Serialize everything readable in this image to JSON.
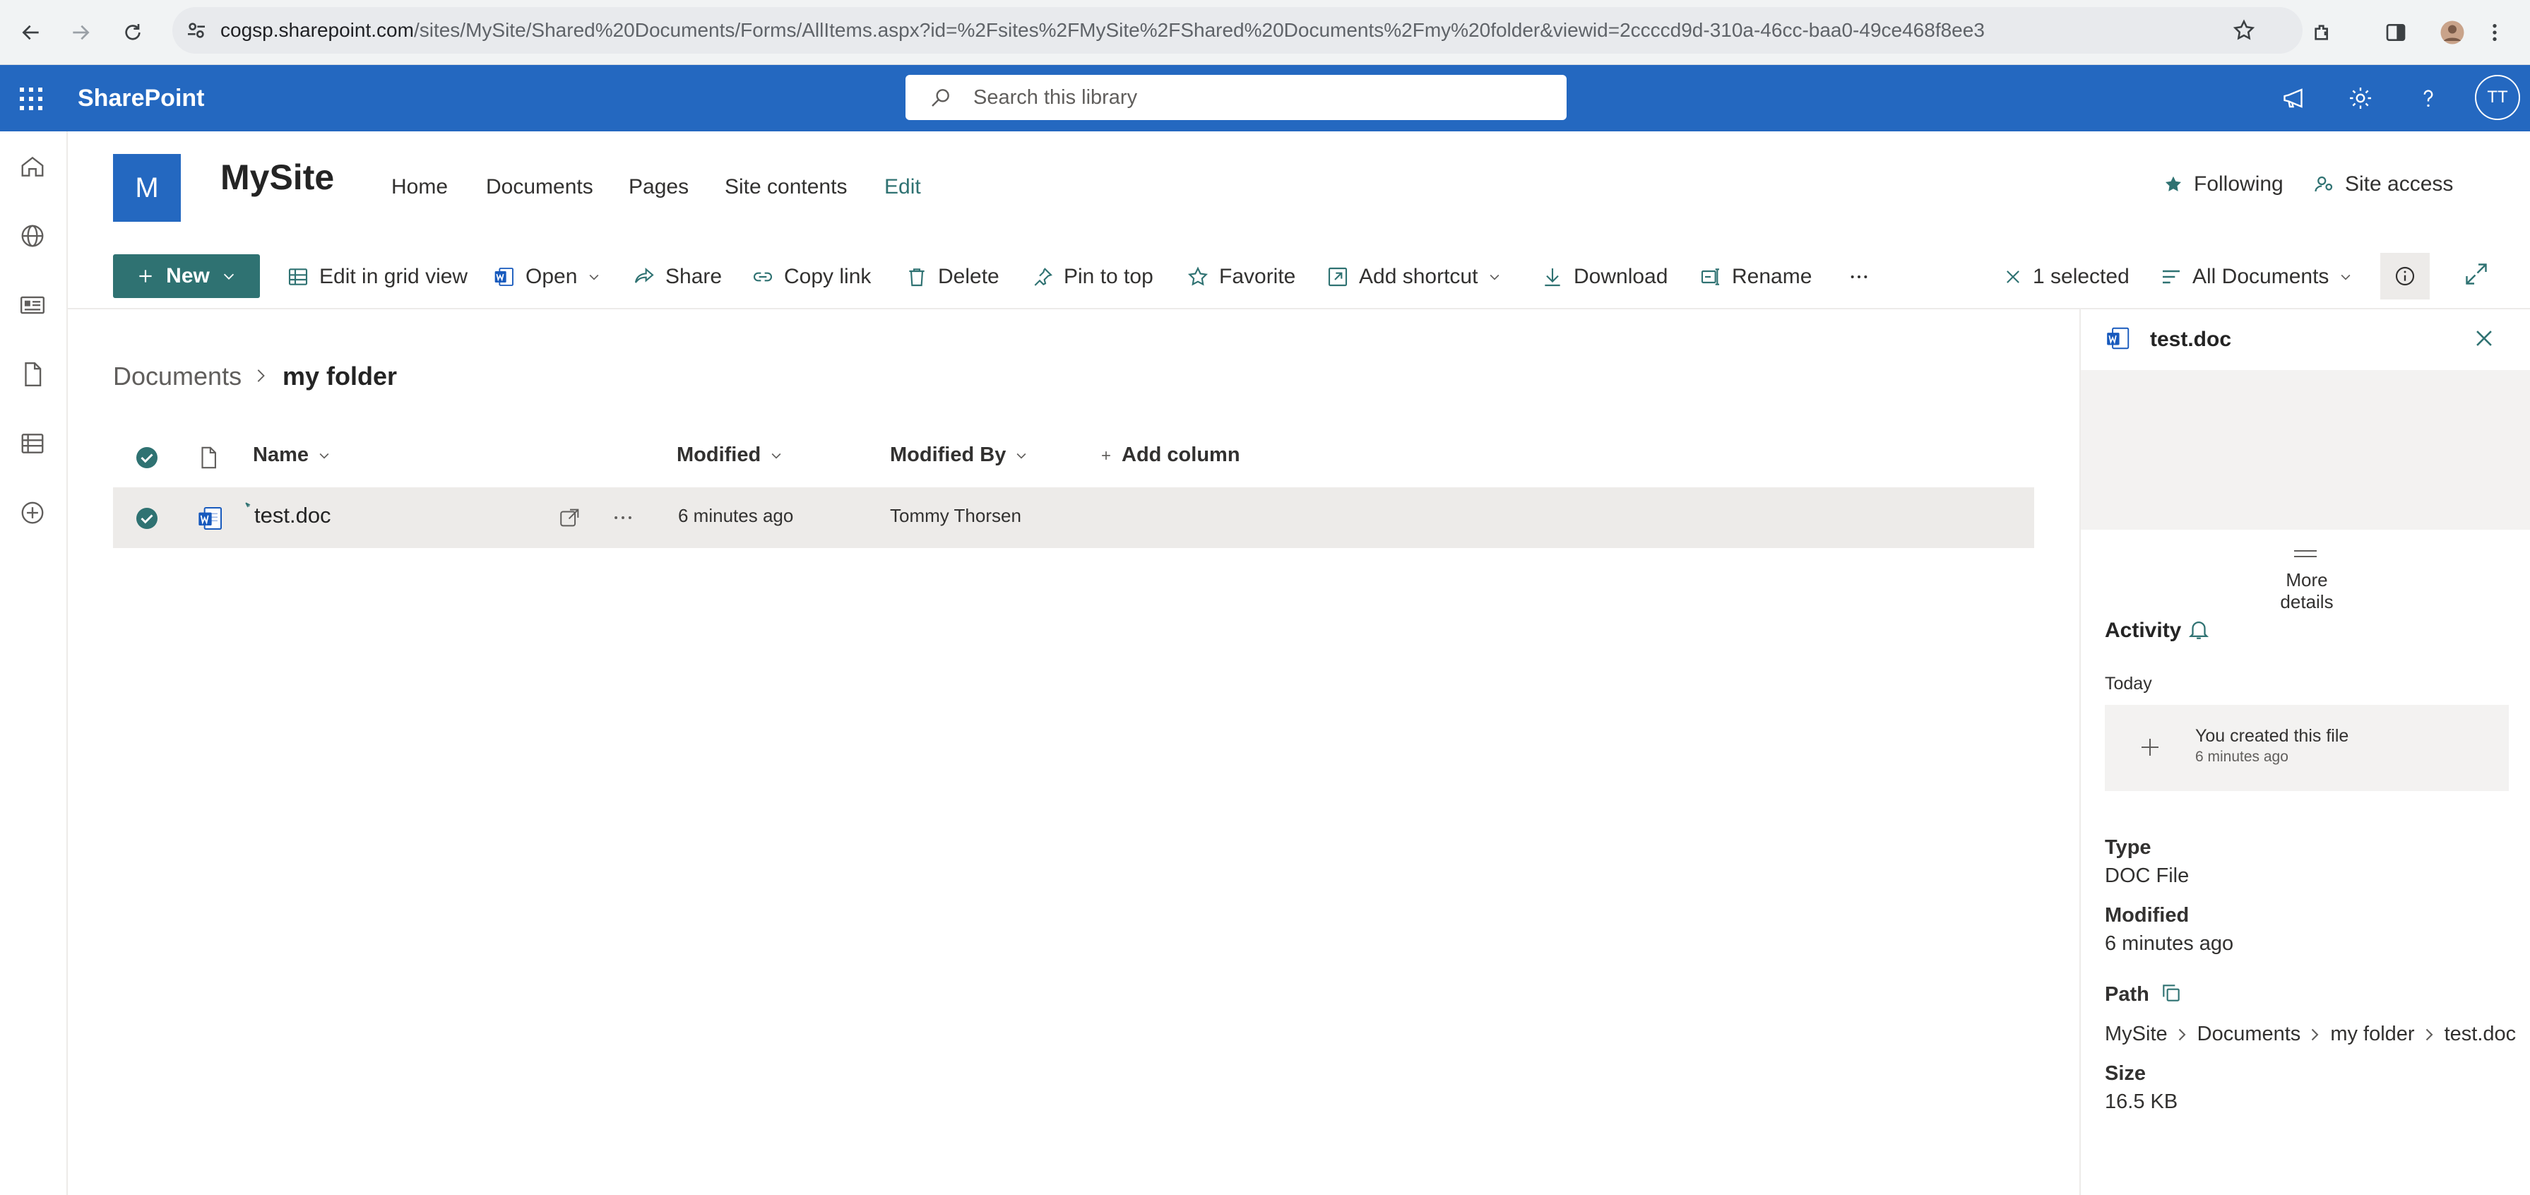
{
  "browser": {
    "url_host": "cogsp.sharepoint.com",
    "url_path": "/sites/MySite/Shared%20Documents/Forms/AllItems.aspx?id=%2Fsites%2FMySite%2FShared%20Documents%2Fmy%20folder&viewid=2ccccd9d-310a-46cc-baa0-49ce468f8ee3"
  },
  "header": {
    "brand": "SharePoint",
    "search_placeholder": "Search this library",
    "avatar_initials": "TT"
  },
  "site": {
    "logo_letter": "M",
    "title": "MySite",
    "nav": [
      "Home",
      "Documents",
      "Pages",
      "Site contents",
      "Edit"
    ],
    "following": "Following",
    "site_access": "Site access"
  },
  "toolbar": {
    "new": "New",
    "edit_grid": "Edit in grid view",
    "open": "Open",
    "share": "Share",
    "copy_link": "Copy link",
    "delete": "Delete",
    "pin": "Pin to top",
    "favorite": "Favorite",
    "add_shortcut": "Add shortcut",
    "download": "Download",
    "rename": "Rename",
    "selected": "1 selected",
    "view": "All Documents"
  },
  "breadcrumb": {
    "parent": "Documents",
    "current": "my folder"
  },
  "table": {
    "columns": {
      "name": "Name",
      "modified": "Modified",
      "modified_by": "Modified By",
      "add_column": "Add column"
    },
    "rows": [
      {
        "name": "test.doc",
        "modified": "6 minutes ago",
        "modified_by": "Tommy Thorsen"
      }
    ]
  },
  "details": {
    "file_name": "test.doc",
    "more_details": "More details",
    "activity_label": "Activity",
    "today_label": "Today",
    "activity_text": "You created this file",
    "activity_time": "6 minutes ago",
    "type_label": "Type",
    "type_value": "DOC File",
    "modified_label": "Modified",
    "modified_value": "6 minutes ago",
    "path_label": "Path",
    "path": [
      "MySite",
      "Documents",
      "my folder",
      "test.doc"
    ],
    "size_label": "Size",
    "size_value": "16.5 KB"
  },
  "colors": {
    "suite_bar": "#2468c0",
    "primary_button": "#2f7272",
    "selected_row": "#edebe9"
  }
}
